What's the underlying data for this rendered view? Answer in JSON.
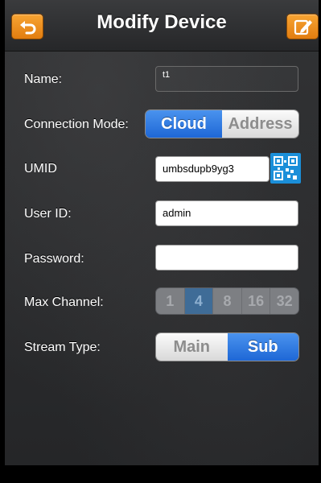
{
  "navbar": {
    "title": "Modify Device",
    "back_icon": "back-arrow-icon",
    "edit_icon": "edit-icon",
    "accent": "#f29222"
  },
  "form": {
    "name": {
      "label": "Name:",
      "value": "t1"
    },
    "connection_mode": {
      "label": "Connection Mode:",
      "options": [
        "Cloud",
        "Address"
      ],
      "selected": "Cloud"
    },
    "umid": {
      "label": "UMID",
      "value": "umbsdupb9yg3",
      "scan_icon": "qr-code-icon"
    },
    "user_id": {
      "label": "User ID:",
      "value": "admin"
    },
    "password": {
      "label": "Password:",
      "value": ""
    },
    "max_channel": {
      "label": "Max Channel:",
      "options": [
        "1",
        "4",
        "8",
        "16",
        "32"
      ],
      "selected": "4"
    },
    "stream_type": {
      "label": "Stream Type:",
      "options": [
        "Main",
        "Sub"
      ],
      "selected": "Sub"
    }
  },
  "colors": {
    "segment_selected": "#2f7be3",
    "background": "#2d2e30"
  }
}
